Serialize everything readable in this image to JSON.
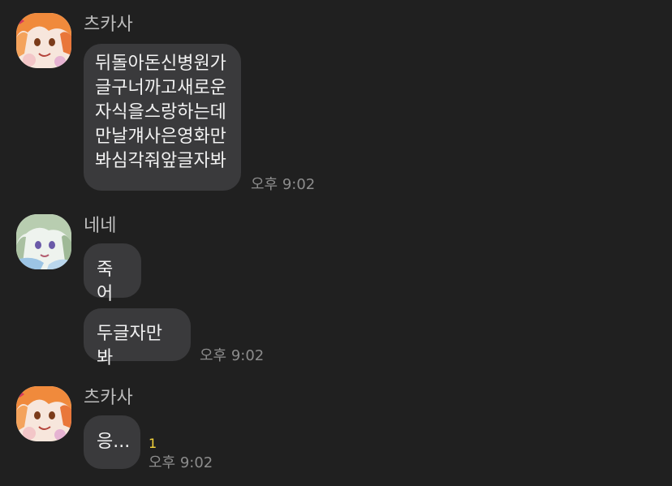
{
  "messages": {
    "group1": {
      "sender": "츠카사",
      "avatar_icon": "orange-haired-character-avatar",
      "bubble_text": "뒤돌아돈신병원가\n글구너까고새로운\n자식을스랑하는데\n만날걔사은영화만\n봐심각줘앞글자봐",
      "time": "오후 9:02"
    },
    "group2": {
      "sender": "네네",
      "avatar_icon": "green-haired-character-avatar",
      "bubble1_text": "죽어",
      "bubble2_text": "두글자만봐",
      "time": "오후 9:02"
    },
    "group3": {
      "sender": "츠카사",
      "avatar_icon": "orange-haired-character-avatar",
      "bubble_text": "응...",
      "unread_count": "1",
      "time": "오후 9:02"
    }
  },
  "colors": {
    "background": "#202020",
    "bubble": "#3a3a3c",
    "unread": "#f5d43c"
  }
}
